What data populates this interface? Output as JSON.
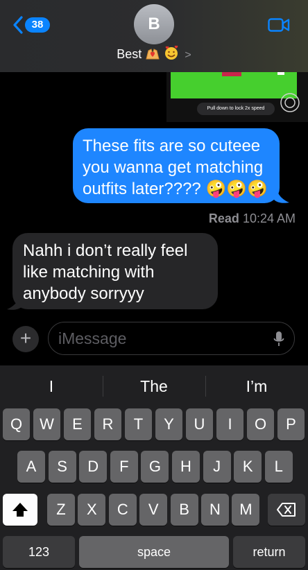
{
  "header": {
    "back_count": "38",
    "avatar_initial": "B",
    "contact_name": "Best",
    "contact_emojis": [
      "hands-heart",
      "smiling-face-with-hearts"
    ],
    "chevron": ">",
    "video_icon": "video-camera-icon"
  },
  "media": {
    "speed_hint": "Pull down to lock 2x speed"
  },
  "messages": [
    {
      "direction": "sent",
      "text": "These fits are so cuteee you wanna get matching outfits later???? 🤪🤪🤪"
    },
    {
      "direction": "received",
      "text": "Nahh i don’t really feel like matching with anybody sorryyy"
    }
  ],
  "receipt": {
    "status": "Read",
    "time": "10:24 AM"
  },
  "composer": {
    "placeholder": "iMessage",
    "plus": "+"
  },
  "keyboard": {
    "suggestions": [
      "I",
      "The",
      "I’m"
    ],
    "row1": [
      "Q",
      "W",
      "E",
      "R",
      "T",
      "Y",
      "U",
      "I",
      "O",
      "P"
    ],
    "row2": [
      "A",
      "S",
      "D",
      "F",
      "G",
      "H",
      "J",
      "K",
      "L"
    ],
    "row3": [
      "Z",
      "X",
      "C",
      "V",
      "B",
      "N",
      "M"
    ],
    "bottom": {
      "numbers": "123",
      "space": "space",
      "return": "return"
    }
  },
  "colors": {
    "sent_bubble": "#1e86ff",
    "received_bubble": "#262628",
    "accent": "#0a84ff"
  }
}
